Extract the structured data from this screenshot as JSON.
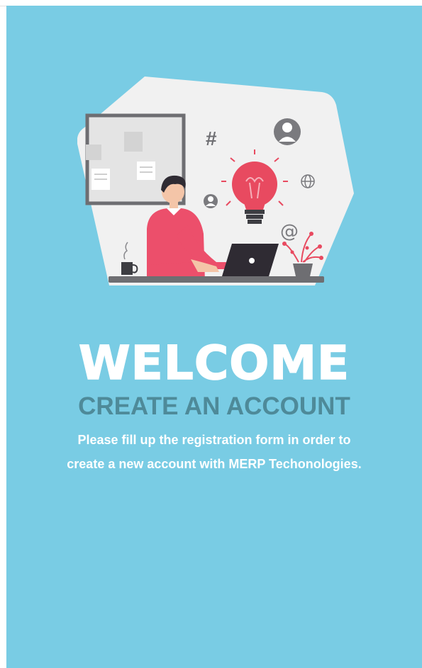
{
  "heading": "WELCOME",
  "subheading": "CREATE AN ACCOUNT",
  "description": "Please fill up the registration form in order to create a new account with MERP Techonologies.",
  "illustration": {
    "hash_symbol": "#",
    "at_symbol": "@"
  },
  "colors": {
    "panel_background": "#79cce4",
    "subheading": "#4e8a99",
    "shirt": "#ec4f6b",
    "bulb": "#e84a60"
  }
}
